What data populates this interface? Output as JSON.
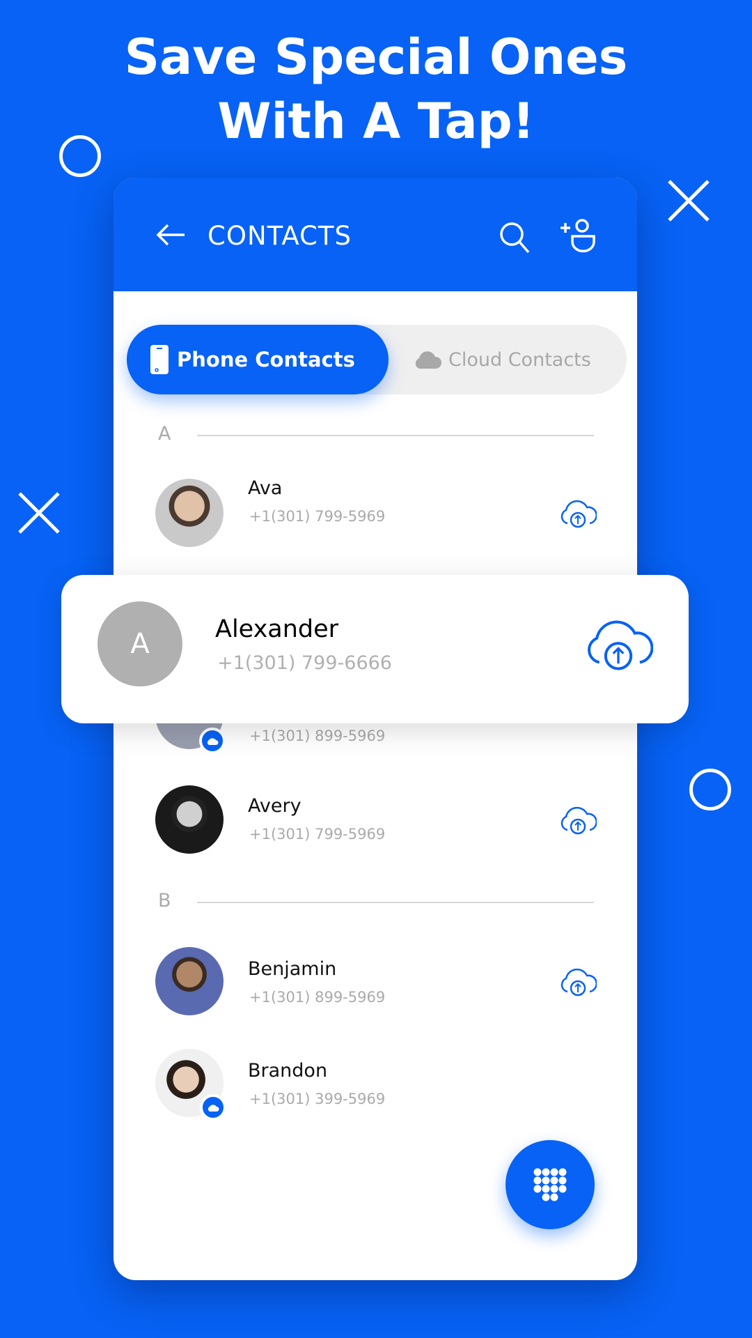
{
  "headline": {
    "line1": "Save Special Ones",
    "line2": "With A Tap!"
  },
  "header": {
    "title": "CONTACTS",
    "back_icon": "arrow-left-icon",
    "search_icon": "search-icon",
    "add_icon": "add-user-icon"
  },
  "tabs": [
    {
      "label": "Phone Contacts",
      "icon": "phone-icon",
      "active": true
    },
    {
      "label": "Cloud Contacts",
      "icon": "cloud-icon",
      "active": false
    }
  ],
  "sections": [
    {
      "letter": "A"
    },
    {
      "letter": "B"
    }
  ],
  "contacts": [
    {
      "name": "Ava",
      "phone": "+1(301) 799-5969"
    },
    {
      "name": "",
      "phone": "+1(301) 899-5969"
    },
    {
      "name": "Avery",
      "phone": "+1(301) 799-5969"
    },
    {
      "name": "Benjamin",
      "phone": "+1(301) 899-5969"
    },
    {
      "name": "Brandon",
      "phone": "+1(301) 399-5969"
    }
  ],
  "highlight": {
    "initial": "A",
    "name": "Alexander",
    "phone": "+1(301) 799-6666"
  },
  "colors": {
    "accent": "#0762F5",
    "placeholder_avatar": "#b0b0b0"
  }
}
